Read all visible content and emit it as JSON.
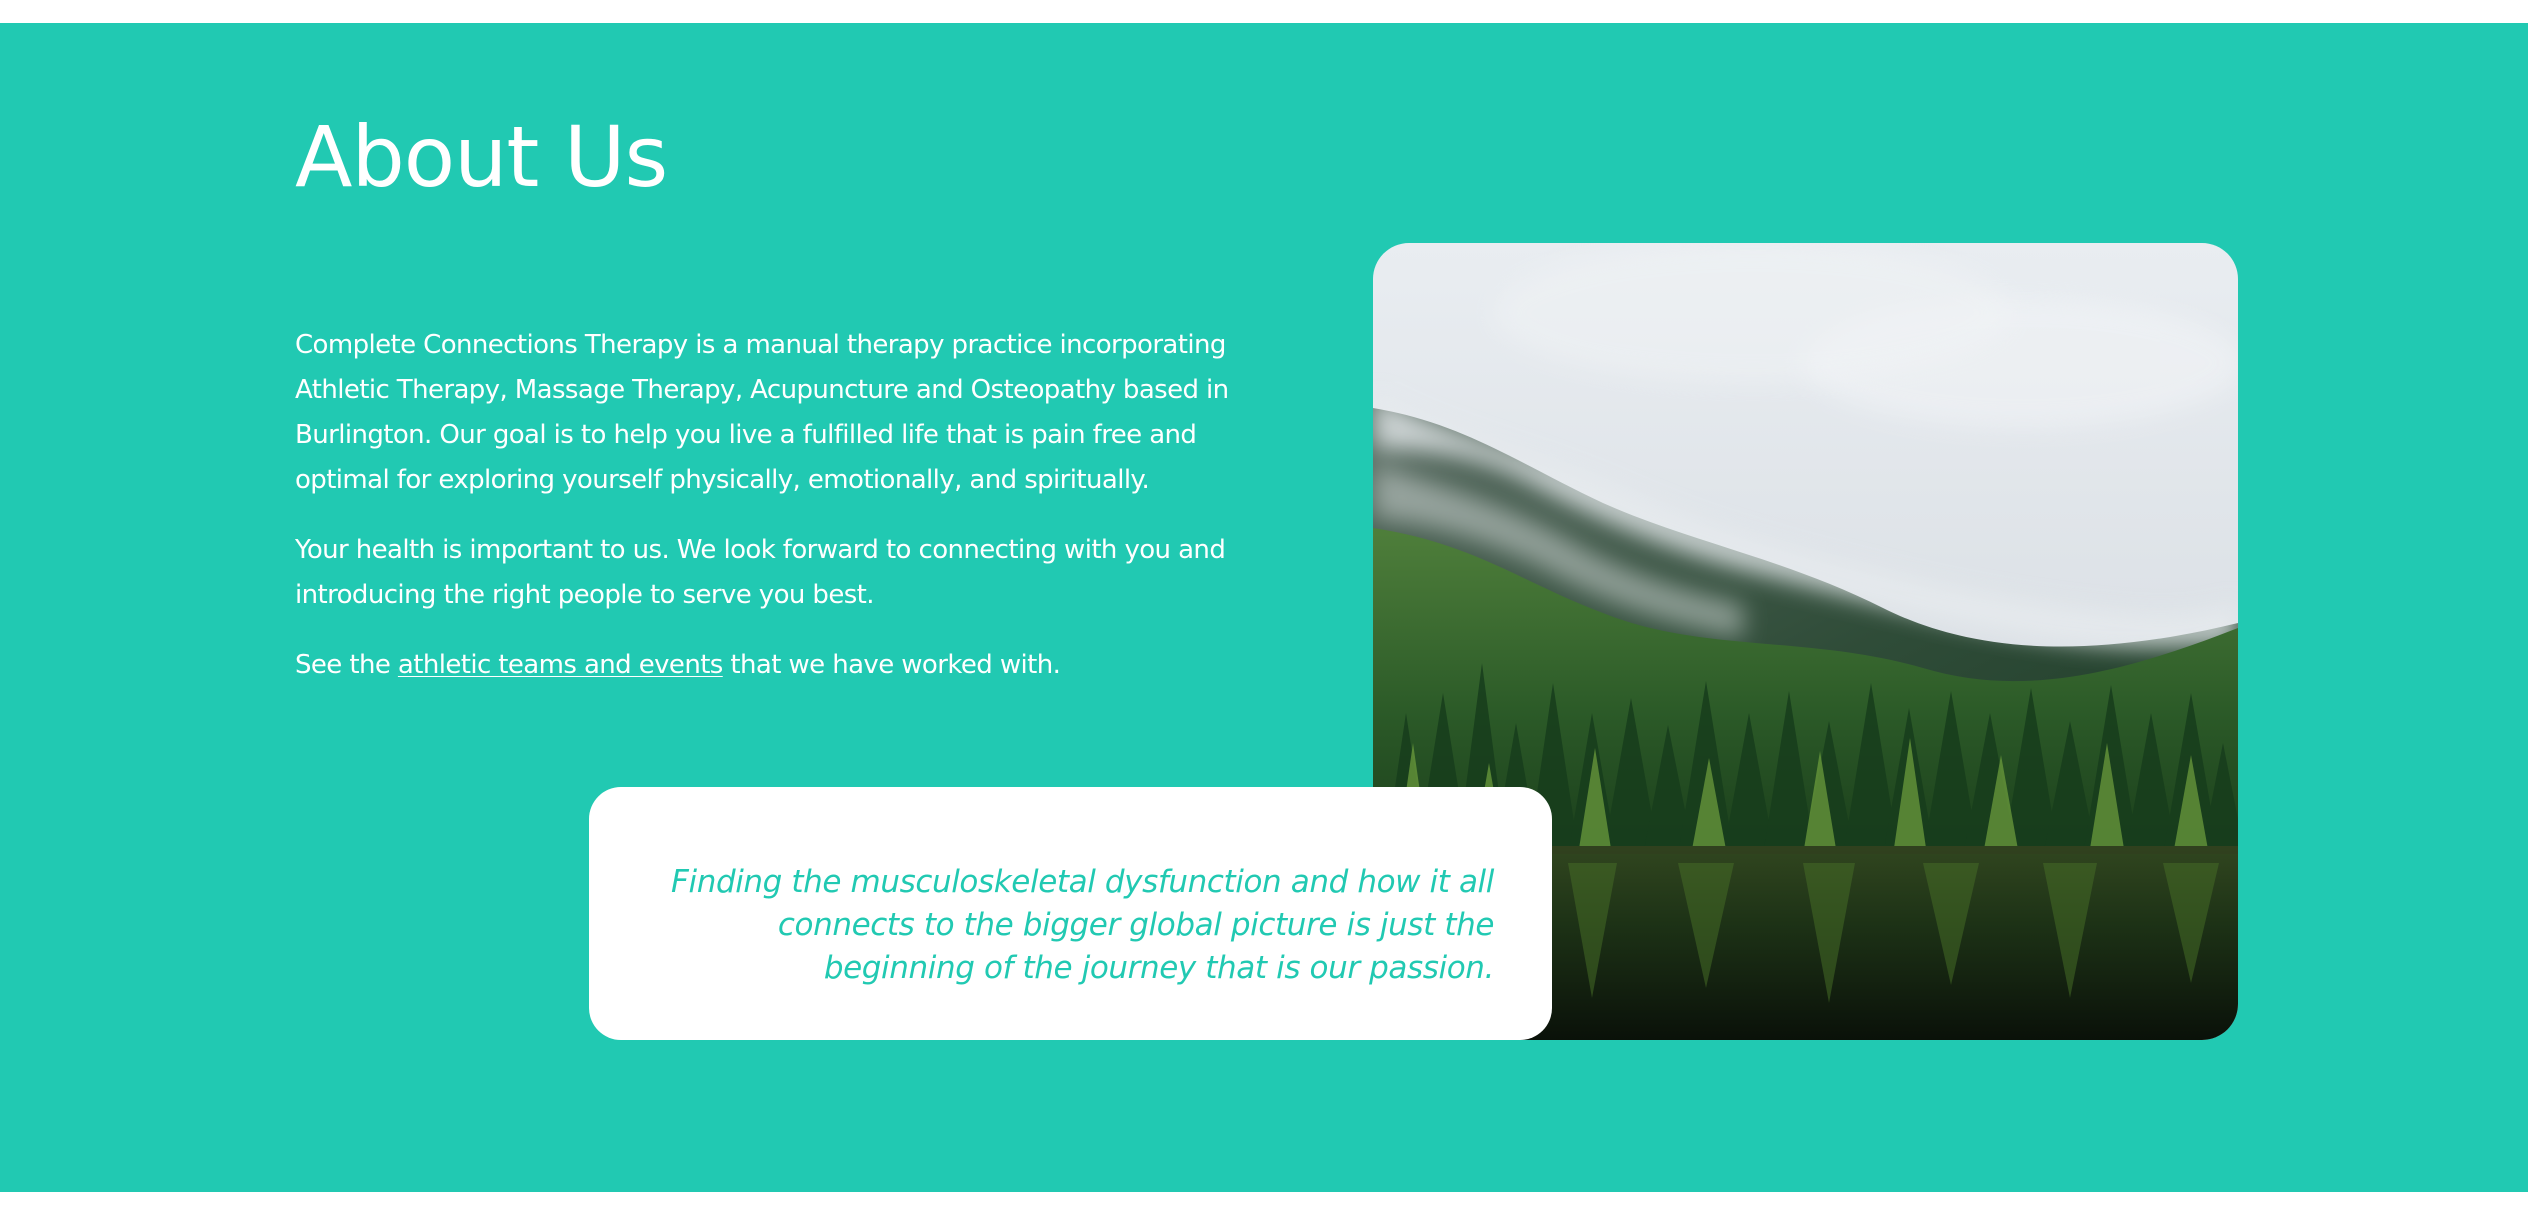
{
  "about": {
    "title": "About Us",
    "paragraph_1": "Complete Connections Therapy is a manual therapy practice incorporating Athletic Therapy, Massage Therapy, Acupuncture and Osteopathy based in Burlington. Our goal is to help you live a fulfilled life that is pain free and optimal for exploring yourself physically, emotionally, and spiritually.",
    "paragraph_2": "Your health is important to us. We look forward to connecting with you and introducing the right people to serve you best.",
    "paragraph_3_prefix": "See the",
    "paragraph_3_link": "athletic teams and events",
    "paragraph_3_suffix": "that we have worked with.",
    "quote": "Finding the musculoskeletal dysfunction and how it all connects to the bigger global picture is just the beginning of the journey that is our passion."
  },
  "colors": {
    "section_background": "#21c9b2",
    "text": "#ffffff",
    "quote_card": "#ffffff",
    "quote_text": "#21c9b2"
  },
  "image": {
    "description": "forest-lake-landscape"
  }
}
